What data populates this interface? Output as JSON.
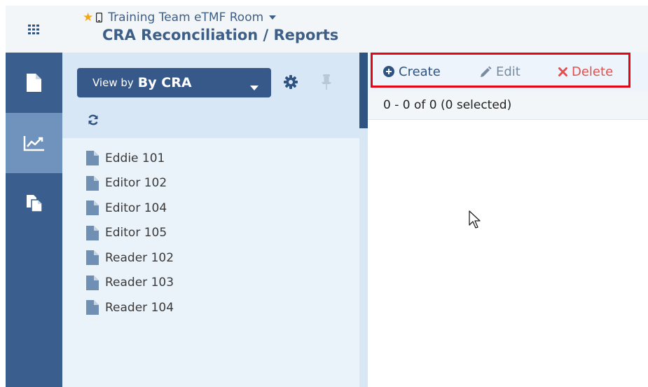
{
  "header": {
    "room_name": "Training Team eTMF Room",
    "page_title": "CRA Reconciliation / Reports"
  },
  "panel": {
    "viewby_label": "View by",
    "viewby_value": "By CRA",
    "items": [
      {
        "label": "Eddie 101"
      },
      {
        "label": "Editor 102"
      },
      {
        "label": "Editor 104"
      },
      {
        "label": "Editor 105"
      },
      {
        "label": "Reader 102"
      },
      {
        "label": "Reader 103"
      },
      {
        "label": "Reader 104"
      }
    ]
  },
  "toolbar": {
    "create_label": "Create",
    "edit_label": "Edit",
    "delete_label": "Delete"
  },
  "list": {
    "count_text": "0 - 0 of 0 (0 selected)"
  },
  "colors": {
    "nav_bg": "#3a5f8f",
    "nav_active": "#6f93bd",
    "accent": "#36598a",
    "star": "#f2a71b",
    "delete": "#e05050",
    "highlight_box": "#e30613"
  }
}
